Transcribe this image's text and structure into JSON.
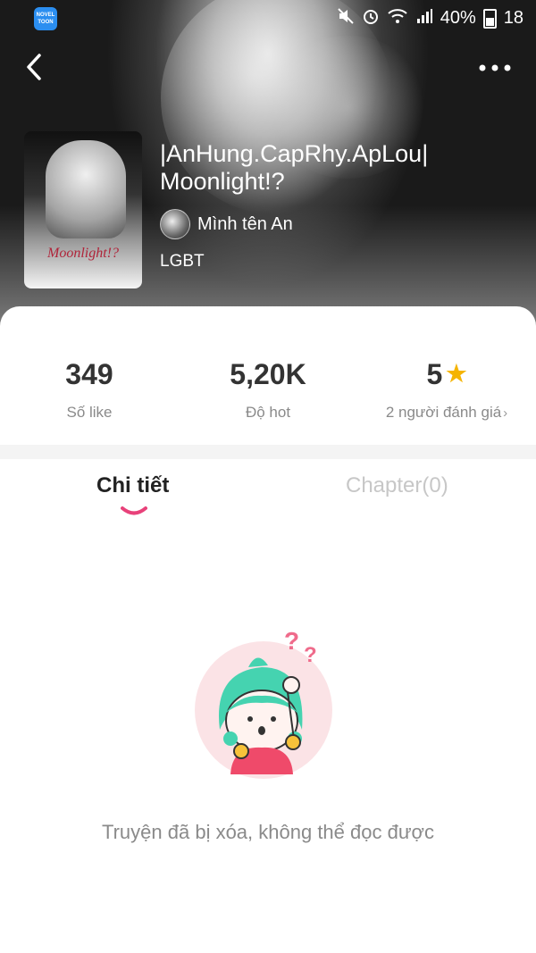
{
  "status_bar": {
    "app_badge": "NOVEL TOON",
    "battery": "40%",
    "time": "18"
  },
  "book": {
    "title": "|AnHung.CapRhy.ApLou| Moonlight!?",
    "author": "Mình tên An",
    "genre": "LGBT",
    "cover_text": "Moonlight!?"
  },
  "stats": {
    "likes_value": "349",
    "likes_label": "Số like",
    "hot_value": "5,20K",
    "hot_label": "Độ hot",
    "rating_value": "5",
    "rating_label": "2 người đánh giá",
    "rating_icon": "star-icon",
    "accent_star": "#f5b400"
  },
  "tabs": {
    "details": "Chi tiết",
    "chapters": "Chapter(0)",
    "active": "details",
    "indicator_color": "#e8417a"
  },
  "empty_state": {
    "message": "Truyện đã bị xóa, không thể đọc được",
    "illustration": "confused-girl-illustration"
  }
}
